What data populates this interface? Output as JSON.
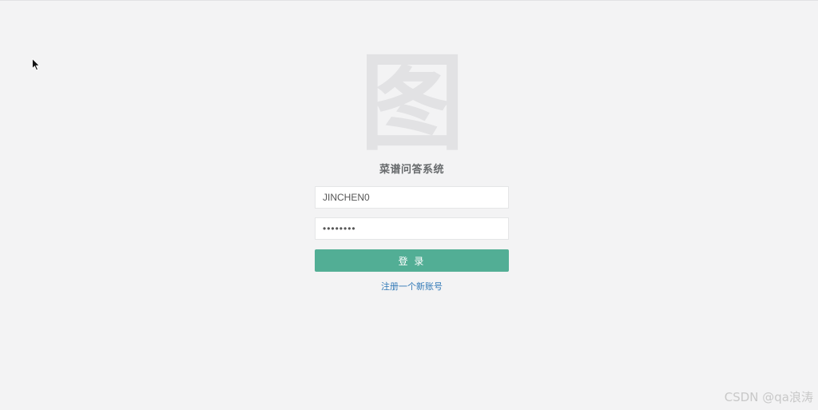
{
  "logo": {
    "glyph": "图",
    "icon": "image-placeholder-icon",
    "color": "#e2e2e4"
  },
  "app": {
    "title": "菜谱问答系统"
  },
  "form": {
    "username_value": "JINCHEN0",
    "password_value": "••••••••"
  },
  "login_button": {
    "label": "登 录",
    "color": "#52ae95"
  },
  "register_link": {
    "label": "注册一个新账号",
    "color": "#337ab7"
  },
  "watermark": {
    "text": "CSDN @qa浪涛"
  },
  "cursor": {
    "icon": "mouse-pointer-icon"
  }
}
